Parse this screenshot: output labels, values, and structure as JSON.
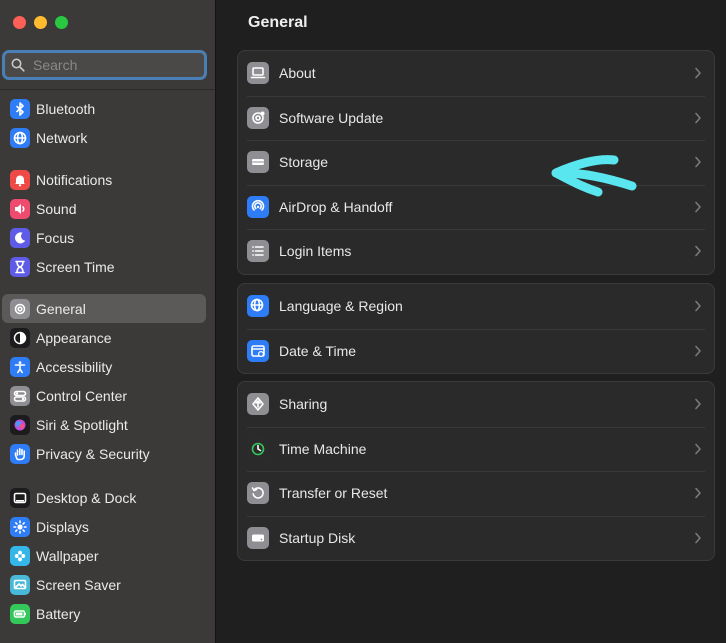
{
  "window": {
    "traffic_lights": [
      "close",
      "minimize",
      "zoom"
    ]
  },
  "search": {
    "placeholder": "Search",
    "value": ""
  },
  "sidebar": {
    "groups": [
      [
        {
          "label": "Bluetooth",
          "icon": "bluetooth-icon",
          "color": "#2f7df6"
        },
        {
          "label": "Network",
          "icon": "globe-icon",
          "color": "#2f7df6"
        }
      ],
      [
        {
          "label": "Notifications",
          "icon": "bell-icon",
          "color": "#ee4b48"
        },
        {
          "label": "Sound",
          "icon": "speaker-icon",
          "color": "#ee4b6f"
        },
        {
          "label": "Focus",
          "icon": "moon-icon",
          "color": "#5e5ce6"
        },
        {
          "label": "Screen Time",
          "icon": "hourglass-icon",
          "color": "#5e5ce6"
        }
      ],
      [
        {
          "label": "General",
          "icon": "gear-icon",
          "color": "#8e8e93",
          "active": true
        },
        {
          "label": "Appearance",
          "icon": "appearance-icon",
          "color": "#1c1c1e"
        },
        {
          "label": "Accessibility",
          "icon": "accessibility-icon",
          "color": "#2f7df6"
        },
        {
          "label": "Control Center",
          "icon": "toggles-icon",
          "color": "#8e8e93"
        },
        {
          "label": "Siri & Spotlight",
          "icon": "siri-icon",
          "color": "#1c1c1e"
        },
        {
          "label": "Privacy & Security",
          "icon": "hand-icon",
          "color": "#2f7df6"
        }
      ],
      [
        {
          "label": "Desktop & Dock",
          "icon": "dock-icon",
          "color": "#1c1c1e"
        },
        {
          "label": "Displays",
          "icon": "sun-icon",
          "color": "#2f7df6"
        },
        {
          "label": "Wallpaper",
          "icon": "flower-icon",
          "color": "#35b6e8"
        },
        {
          "label": "Screen Saver",
          "icon": "screensaver-icon",
          "color": "#48b9d8"
        },
        {
          "label": "Battery",
          "icon": "battery-icon",
          "color": "#34c759"
        }
      ]
    ]
  },
  "main": {
    "title": "General",
    "panels": [
      [
        {
          "label": "About",
          "icon": "laptop-icon",
          "color": "#8e8e93"
        },
        {
          "label": "Software Update",
          "icon": "gear-badge-icon",
          "color": "#8e8e93"
        },
        {
          "label": "Storage",
          "icon": "drive-icon",
          "color": "#8e8e93"
        },
        {
          "label": "AirDrop & Handoff",
          "icon": "airdrop-icon",
          "color": "#2f7df6"
        },
        {
          "label": "Login Items",
          "icon": "list-icon",
          "color": "#8e8e93"
        }
      ],
      [
        {
          "label": "Language & Region",
          "icon": "globe-icon",
          "color": "#2f7df6"
        },
        {
          "label": "Date & Time",
          "icon": "calendar-clock-icon",
          "color": "#2f7df6"
        }
      ],
      [
        {
          "label": "Sharing",
          "icon": "sharing-icon",
          "color": "#8e8e93"
        },
        {
          "label": "Time Machine",
          "icon": "time-machine-icon",
          "color": "#2b2b2b"
        },
        {
          "label": "Transfer or Reset",
          "icon": "reset-icon",
          "color": "#8e8e93"
        },
        {
          "label": "Startup Disk",
          "icon": "disk-icon",
          "color": "#8e8e93"
        }
      ]
    ]
  },
  "annotation": {
    "color": "#5ae6ef"
  }
}
